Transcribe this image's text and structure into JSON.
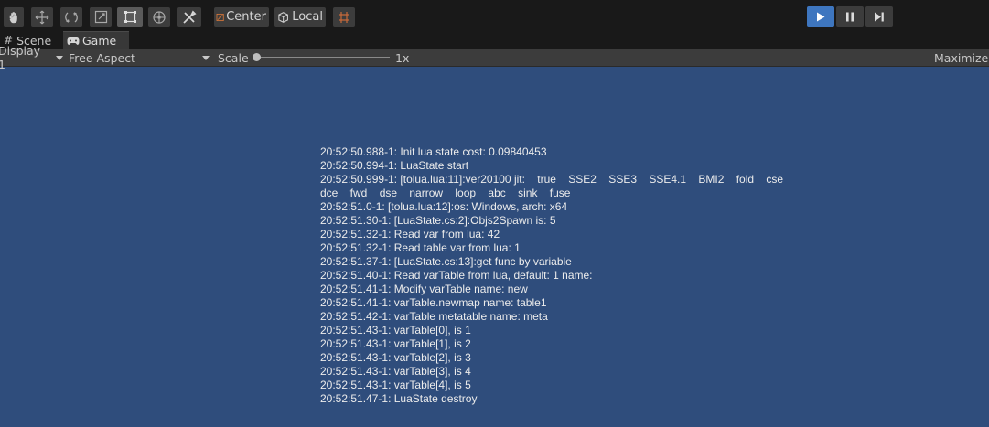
{
  "toolbar": {
    "tools": [
      "hand-tool",
      "move-tool",
      "rotate-tool",
      "scale-tool",
      "rect-tool",
      "transform-tool",
      "custom-tool"
    ],
    "pivot_label": "Center",
    "space_label": "Local",
    "grid_snap": "grid-snap"
  },
  "tabs": [
    {
      "label": "Scene",
      "icon": "scene-icon"
    },
    {
      "label": "Game",
      "icon": "gamepad-icon"
    }
  ],
  "game_bar": {
    "display": "Display 1",
    "aspect": "Free Aspect",
    "scale_label": "Scale",
    "scale_value": "1x",
    "maximize": "Maximize O"
  },
  "log_lines": [
    "20:52:50.988-1: Init lua state cost: 0.09840453",
    "20:52:50.994-1: LuaState start",
    "20:52:50.999-1: [tolua.lua:11]:ver20100 jit:    true    SSE2    SSE3    SSE4.1    BMI2    fold    cse",
    "dce    fwd    dse    narrow    loop    abc    sink    fuse",
    "20:52:51.0-1: [tolua.lua:12]:os: Windows, arch: x64",
    "20:52:51.30-1: [LuaState.cs:2]:Objs2Spawn is: 5",
    "20:52:51.32-1: Read var from lua: 42",
    "20:52:51.32-1: Read table var from lua: 1",
    "20:52:51.37-1: [LuaState.cs:13]:get func by variable",
    "20:52:51.40-1: Read varTable from lua, default: 1 name:",
    "20:52:51.41-1: Modify varTable name: new",
    "20:52:51.41-1: varTable.newmap name: table1",
    "20:52:51.42-1: varTable metatable name: meta",
    "20:52:51.43-1: varTable[0], is 1",
    "20:52:51.43-1: varTable[1], is 2",
    "20:52:51.43-1: varTable[2], is 3",
    "20:52:51.43-1: varTable[3], is 4",
    "20:52:51.43-1: varTable[4], is 5",
    "20:52:51.47-1: LuaState destroy"
  ],
  "colors": {
    "game_background": "#2f4d7c",
    "play_active": "#3e76bf",
    "toolbar_bg": "#191919"
  }
}
